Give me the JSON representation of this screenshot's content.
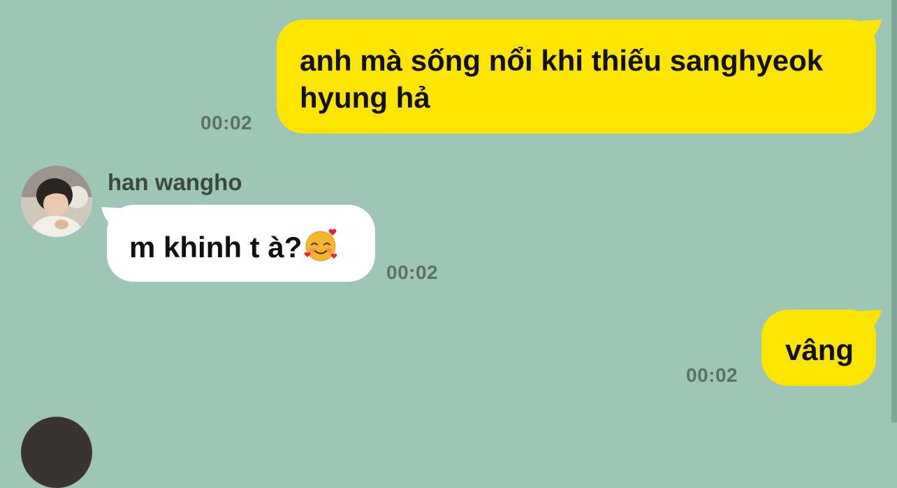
{
  "messages": [
    {
      "direction": "outgoing",
      "text": "anh mà sống nổi khi thiếu sanghyeok hyung hả",
      "time": "00:02"
    },
    {
      "direction": "incoming",
      "sender": "han wangho",
      "text": "m khinh t à?",
      "emoji": "smiling-face-with-hearts",
      "time": "00:02"
    },
    {
      "direction": "outgoing",
      "text": "vâng",
      "time": "00:02"
    }
  ],
  "colors": {
    "background": "#9dc6b6",
    "outgoing_bubble": "#fee500",
    "incoming_bubble": "#ffffff",
    "timestamp": "#5d7266"
  }
}
